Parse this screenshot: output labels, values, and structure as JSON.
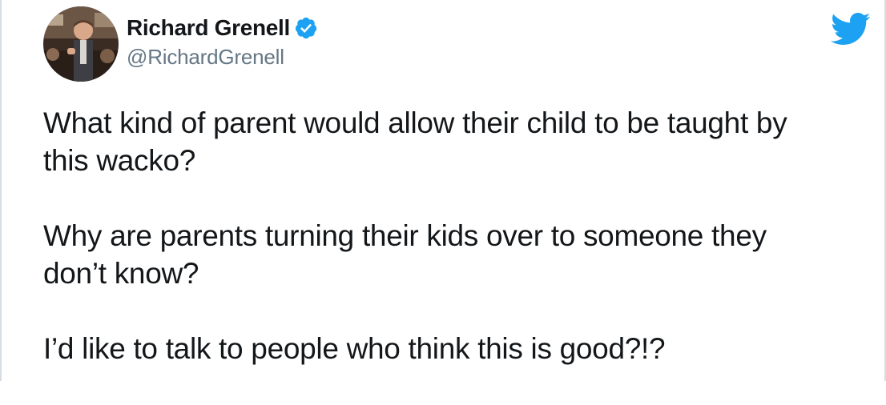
{
  "author": {
    "display_name": "Richard Grenell",
    "handle": "@RichardGrenell",
    "verified": true,
    "avatar_icon": "profile-photo"
  },
  "brand": {
    "logo_icon": "twitter-bird-icon",
    "accent_color": "#1da1f2"
  },
  "tweet": {
    "paragraphs": [
      "What kind of parent would allow their child to be taught by\nthis wacko?",
      "Why are parents turning their kids over to someone they\ndon’t know?",
      "I’d like to talk to people who think this is good?!?"
    ]
  }
}
